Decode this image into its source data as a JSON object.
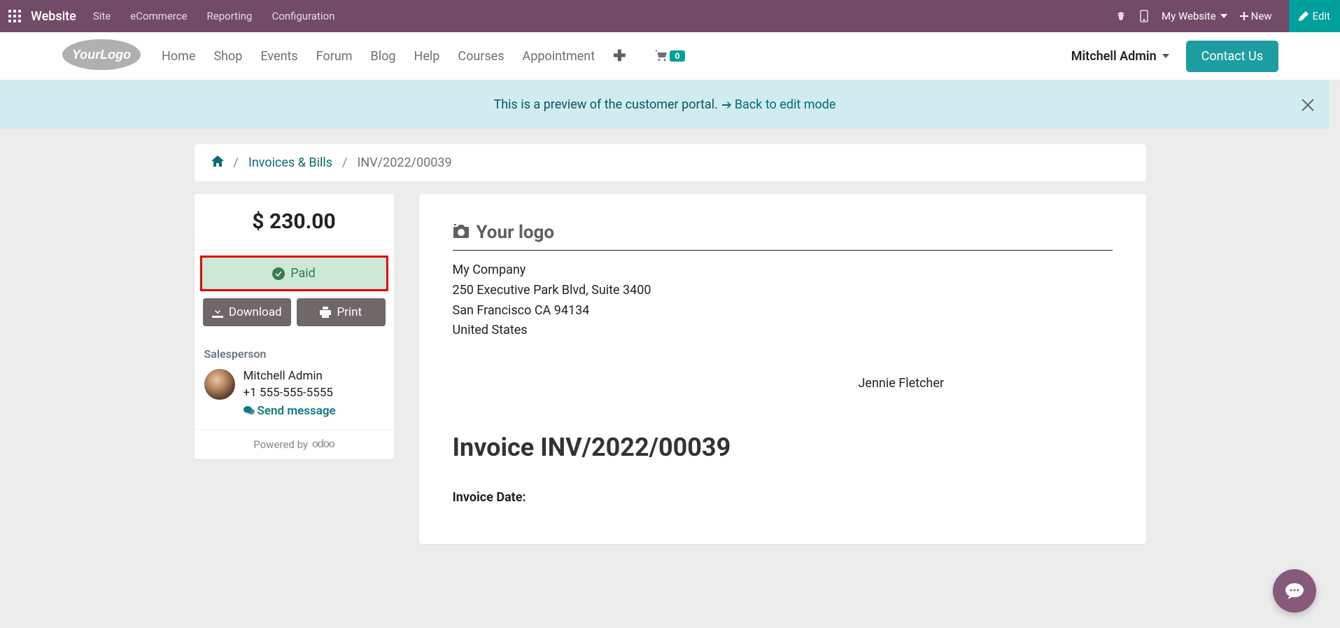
{
  "topbar": {
    "title": "Website",
    "menu": [
      "Site",
      "eCommerce",
      "Reporting",
      "Configuration"
    ],
    "website_selector": "My Website",
    "new_label": "New",
    "edit_label": "Edit"
  },
  "sitebar": {
    "nav": [
      "Home",
      "Shop",
      "Events",
      "Forum",
      "Blog",
      "Help",
      "Courses",
      "Appointment"
    ],
    "cart_count": "0",
    "user": "Mitchell Admin",
    "contact_label": "Contact Us"
  },
  "banner": {
    "text": "This is a preview of the customer portal.",
    "link_text": "Back to edit mode"
  },
  "breadcrumb": {
    "invoices_label": "Invoices & Bills",
    "current": "INV/2022/00039"
  },
  "sidebar": {
    "amount": "$ 230.00",
    "paid_label": "Paid",
    "download_label": "Download",
    "print_label": "Print",
    "salesperson_label": "Salesperson",
    "sp_name": "Mitchell Admin",
    "sp_phone": "+1 555-555-5555",
    "send_msg": "Send message",
    "powered_by": "Powered by",
    "odoo": "odoo"
  },
  "invoice": {
    "logo_text": "Your logo",
    "company": "My Company",
    "street": "250 Executive Park Blvd, Suite 3400",
    "city": "San Francisco CA 94134",
    "country": "United States",
    "customer": "Jennie Fletcher",
    "title": "Invoice INV/2022/00039",
    "date_label": "Invoice Date:"
  }
}
